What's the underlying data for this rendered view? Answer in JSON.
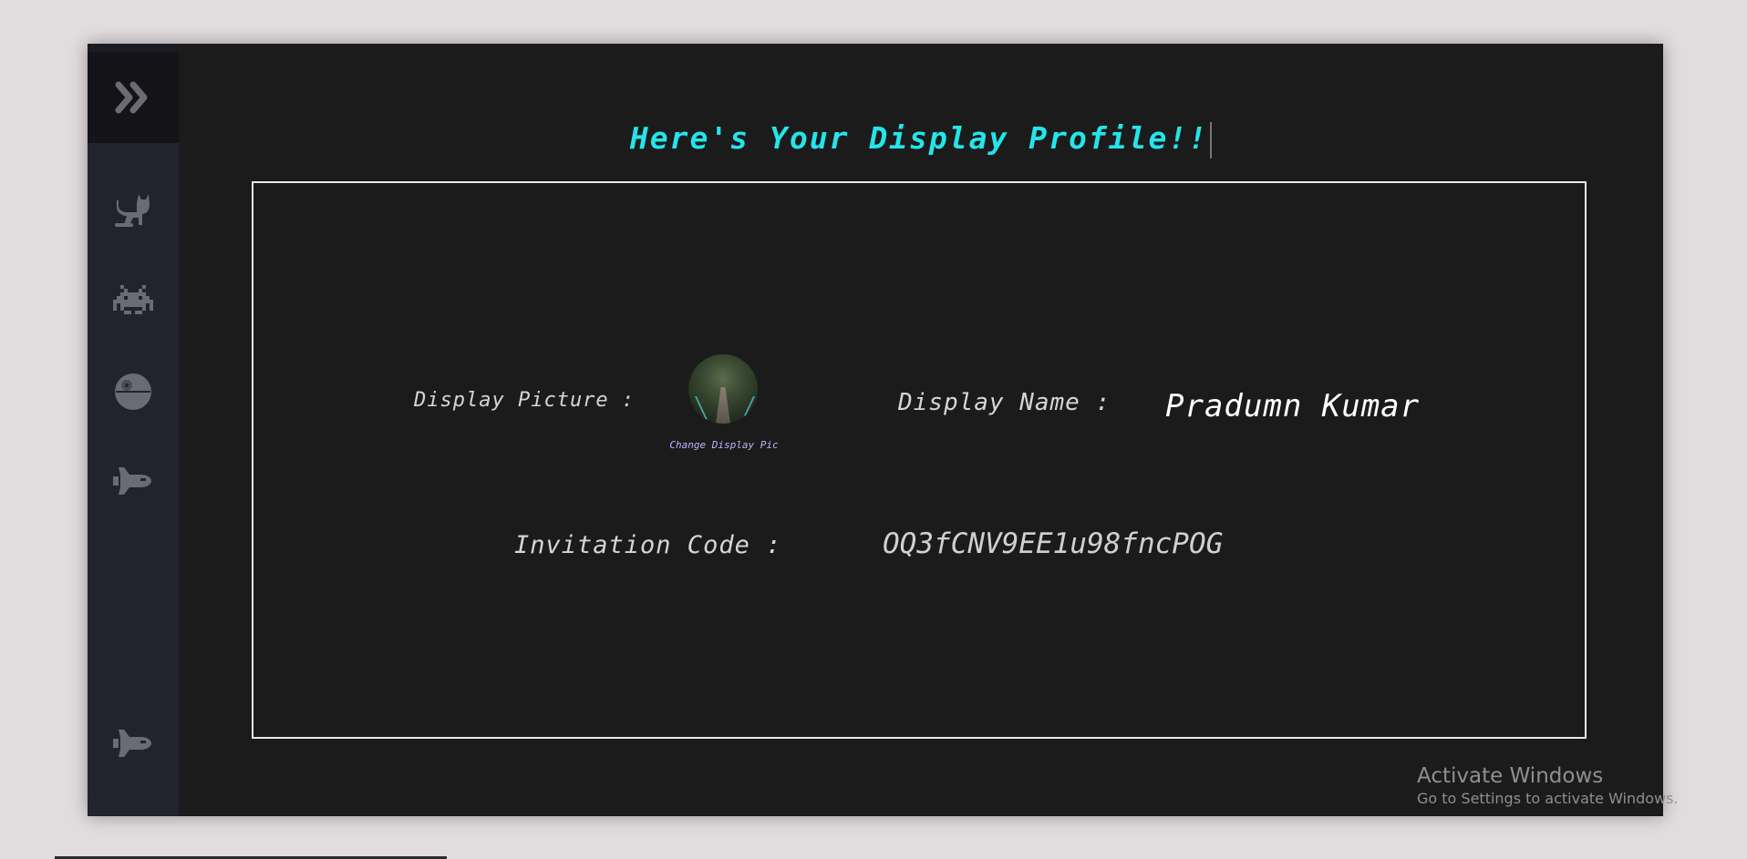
{
  "page": {
    "title": "Here's Your Display Profile!!"
  },
  "sidebar": {
    "toggle_icon": "double-chevron-right-icon",
    "items": [
      {
        "icon": "cat-icon"
      },
      {
        "icon": "space-invader-icon"
      },
      {
        "icon": "death-star-icon"
      },
      {
        "icon": "space-shuttle-icon"
      },
      {
        "icon": "space-shuttle-icon"
      }
    ]
  },
  "profile": {
    "picture_label": "Display Picture :",
    "change_pic_label": "Change Display Pic",
    "name_label": "Display Name :",
    "name_value": "Pradumn Kumar",
    "code_label": "Invitation Code :",
    "code_value": "OQ3fCNV9EE1u98fncPOG"
  },
  "watermark": {
    "title": "Activate Windows",
    "subtitle": "Go to Settings to activate Windows."
  },
  "colors": {
    "accent": "#23e5ea",
    "background": "#1b1b1b",
    "sidebar": "#23232e",
    "icon": "#6b6b73",
    "link": "#b9b6ff"
  }
}
